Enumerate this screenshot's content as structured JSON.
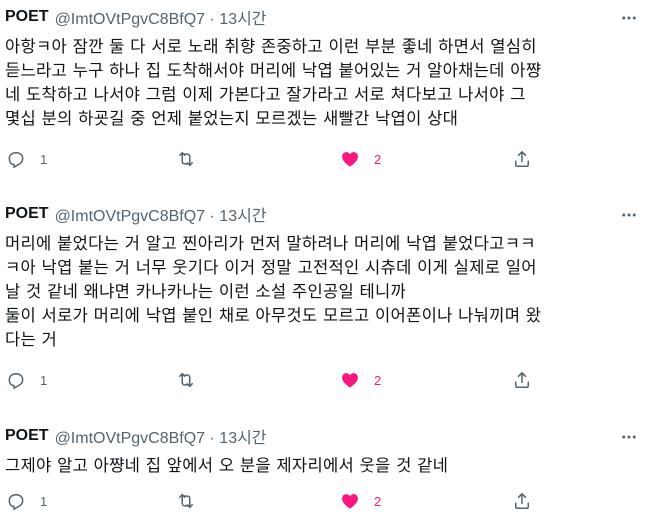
{
  "tweets": [
    {
      "name": "POET",
      "meta": "@ImtOVtPgvC8BfQ7 · 13시간",
      "lines": [
        "아항ㅋ아 잠깐 둘 다 서로 노래 취향 존중하고 이런 부분 좋네 하면서 열심히",
        "듣느라고 누구 하나 집 도착해서야 머리에 낙엽 붙어있는 거 알아채는데 아쨩",
        "네 도착하고 나서야 그럼 이제 가본다고 잘가라고 서로 쳐다보고 나서야 그",
        "몇십 분의 하굣길 중 언제 붙었는지 모르겠는 새빨간 낙엽이 상대"
      ],
      "reply_count": "1",
      "like_count": "2"
    },
    {
      "name": "POET",
      "meta": "@ImtOVtPgvC8BfQ7 · 13시간",
      "lines": [
        "머리에 붙었다는 거 알고 찐아리가 먼저 말하려나 머리에 낙엽 붙었다고ㅋㅋ",
        "ㅋ아 낙엽 붙는 거 너무 웃기다 이거 정말 고전적인 시츄데 이게 실제로 일어",
        "날 것 같네 왜냐면 카나카나는 이런 소설 주인공일 테니까",
        "둘이 서로가 머리에 낙엽 붙인 채로 아무것도 모르고 이어폰이나 나눠끼며 왔",
        "다는 거"
      ],
      "reply_count": "1",
      "like_count": "2"
    },
    {
      "name": "POET",
      "meta": "@ImtOVtPgvC8BfQ7 · 13시간",
      "lines": [
        "그제야 알고 아쨩네 집 앞에서 오 분을 제자리에서 웃을 것 같네"
      ],
      "reply_count": "1",
      "like_count": "2"
    }
  ],
  "colors": {
    "icon_gray": "#536471",
    "like_pink": "#f91880",
    "text": "#0f1419"
  },
  "icons": [
    "more-icon",
    "reply-icon",
    "retweet-icon",
    "like-icon",
    "share-icon"
  ]
}
